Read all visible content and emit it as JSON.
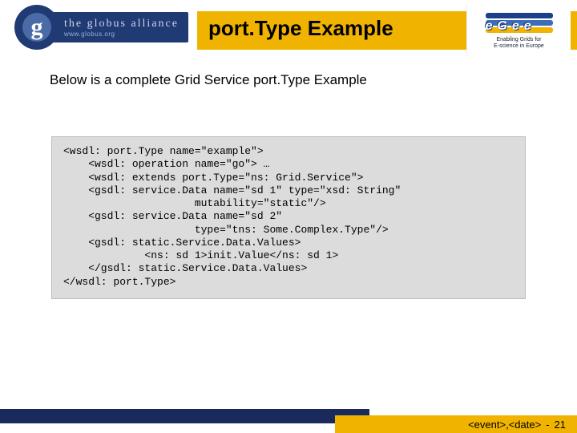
{
  "header": {
    "globus_line1": "the globus alliance",
    "globus_line2": "www.globus.org",
    "globus_g": "g",
    "title": "port.Type Example",
    "egee_letters": "eGee",
    "egee_tagline1": "Enabling Grids for",
    "egee_tagline2": "E-science in Europe"
  },
  "subtitle": "Below is a complete Grid Service port.Type Example",
  "code": {
    "l1": "<wsdl: port.Type name=\"example\">",
    "l2": "    <wsdl: operation name=\"go\"> …",
    "l3": "    <wsdl: extends port.Type=\"ns: Grid.Service\">",
    "l4": "    <gsdl: service.Data name=\"sd 1\" type=\"xsd: String\"",
    "l5": "                     mutability=\"static\"/>",
    "l6": "    <gsdl: service.Data name=\"sd 2\"",
    "l7": "                     type=\"tns: Some.Complex.Type\"/>",
    "l8": "    <gsdl: static.Service.Data.Values>",
    "l9": "             <ns: sd 1>init.Value</ns: sd 1>",
    "l10": "    </gsdl: static.Service.Data.Values>",
    "l11": "</wsdl: port.Type>"
  },
  "footer": {
    "event": "<event>",
    "comma": ", ",
    "date": "<date>",
    "sep": " - ",
    "page": "21"
  }
}
